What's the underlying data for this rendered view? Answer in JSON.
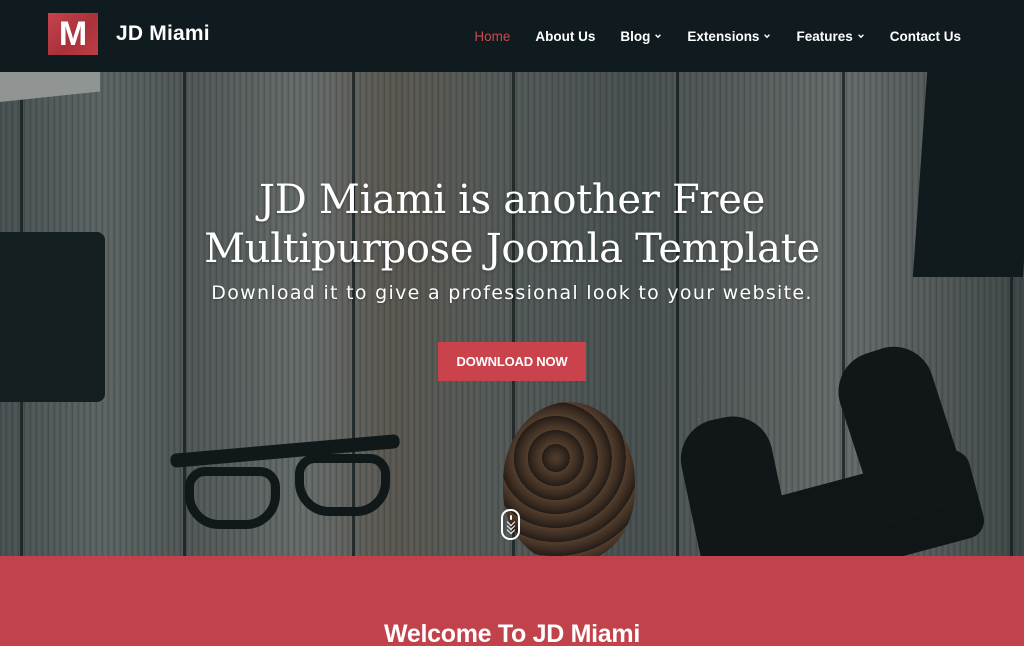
{
  "header": {
    "logo_letter": "M",
    "site_name": "JD Miami",
    "nav": [
      {
        "label": "Home",
        "active": true,
        "has_dropdown": false
      },
      {
        "label": "About Us",
        "active": false,
        "has_dropdown": false
      },
      {
        "label": "Blog",
        "active": false,
        "has_dropdown": true
      },
      {
        "label": "Extensions",
        "active": false,
        "has_dropdown": true
      },
      {
        "label": "Features",
        "active": false,
        "has_dropdown": true
      },
      {
        "label": "Contact Us",
        "active": false,
        "has_dropdown": false
      }
    ]
  },
  "hero": {
    "title_line1": "JD Miami is another Free",
    "title_line2": "Multipurpose Joomla Template",
    "subtitle": "Download it to give a professional look to your website.",
    "cta_label": "DOWNLOAD NOW",
    "scroll_icon": "mouse-scroll-down-icon"
  },
  "welcome": {
    "title": "Welcome To JD Miami"
  },
  "colors": {
    "header_bg": "#0f1b1f",
    "accent": "#c2424b",
    "nav_active": "#c84a50",
    "text_light": "#ffffff"
  }
}
